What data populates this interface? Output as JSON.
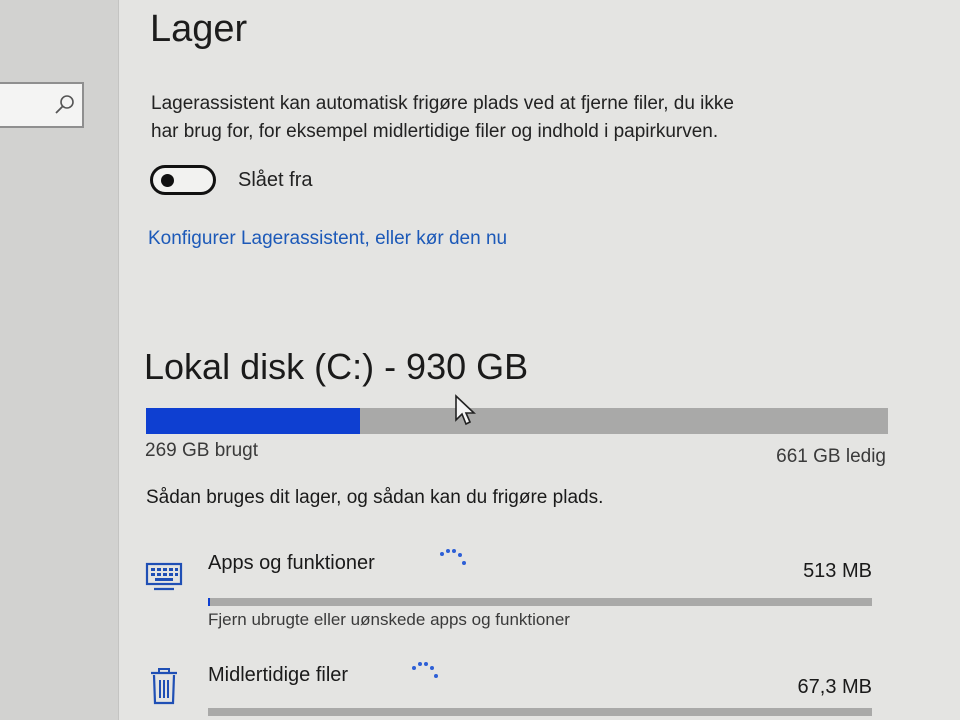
{
  "storage": {
    "title": "Lager",
    "description_line1": "Lagerassistent kan automatisk frigøre plads ved at fjerne filer, du ikke",
    "description_line2": "har brug for, for eksempel midlertidige filer og indhold i papirkurven.",
    "toggle": {
      "state": "off",
      "label": "Slået fra"
    },
    "configure_link": "Konfigurer Lagerassistent, eller kør den nu"
  },
  "disk": {
    "title": "Lokal disk (C:) - 930 GB",
    "used_label": "269 GB brugt",
    "free_label": "661 GB ledig",
    "used_fraction": 0.289,
    "intro": "Sådan bruges dit lager, og sådan kan du frigøre plads.",
    "categories": [
      {
        "name": "Apps og funktioner",
        "size": "513 MB",
        "description": "Fjern ubrugte eller uønskede apps og funktioner",
        "icon": "keyboard-icon",
        "fill_fraction": 0.003
      },
      {
        "name": "Midlertidige filer",
        "size": "67,3 MB",
        "icon": "trash-icon",
        "fill_fraction": 0.0
      }
    ]
  },
  "colors": {
    "accent": "#0e3fd1",
    "link": "#1c59b8",
    "bar_track": "#a9a9a8"
  }
}
